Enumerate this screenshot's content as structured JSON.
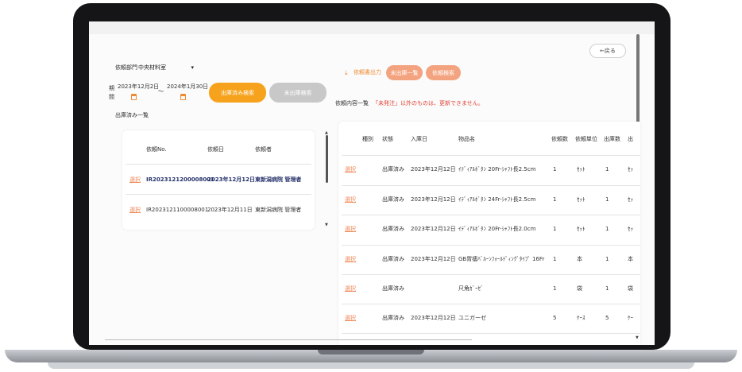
{
  "back_button": "←戻る",
  "filter": {
    "dept_label": "依頼部門",
    "dept_value": "中央材料室",
    "dept_chevron": "▾",
    "period_label": "期間",
    "date_from": "2023年12月2日",
    "date_separator": "～",
    "date_to": "2024年1月30日",
    "search_shipped_button": "出庫済み検索",
    "search_unshipped_button": "未出庫検索"
  },
  "actions": {
    "download_icon": "⤓",
    "request_output_label": "依頼書出力",
    "unshipped_list_button": "未出庫一覧",
    "request_search_button": "依頼検索"
  },
  "left_panel": {
    "title": "出庫済み一覧",
    "headers": [
      "依頼No.",
      "依頼日",
      "依頼者"
    ],
    "rows": [
      {
        "select": "選択",
        "no": "IR2023121200008001",
        "date": "2023年12月12日",
        "requester": "東新潟病院 管理者"
      },
      {
        "select": "選択",
        "no": "IR2023121100008001",
        "date": "2023年12月11日",
        "requester": "東新潟病院 管理者"
      }
    ]
  },
  "right_panel": {
    "title_prefix": "依頼内容一覧",
    "notice": "「未発注」以外のものは、更新できません。",
    "headers": [
      "種別",
      "状態",
      "入庫日",
      "物品名",
      "依頼数",
      "依頼単位",
      "出庫数",
      "出"
    ],
    "rows": [
      {
        "select": "選択",
        "status": "出庫済み",
        "date": "2023年12月12日",
        "item": "ｲﾃﾞｨｱﾙﾎﾞﾀﾝ 20Fr-ｼｬﾌﾄ長2.5cm",
        "qty": "1",
        "unit": "ｾｯﾄ",
        "out_qty": "1",
        "out_unit": "ｾｯ"
      },
      {
        "select": "選択",
        "status": "出庫済み",
        "date": "2023年12月12日",
        "item": "ｲﾃﾞｨｱﾙﾎﾞﾀﾝ 24Fr-ｼｬﾌﾄ長2.5cm",
        "qty": "1",
        "unit": "ｾｯﾄ",
        "out_qty": "1",
        "out_unit": "ｾｯ"
      },
      {
        "select": "選択",
        "status": "出庫済み",
        "date": "2023年12月12日",
        "item": "ｲﾃﾞｨｱﾙﾎﾞﾀﾝ 20Fr-ｼｬﾌﾄ長2.0cm",
        "qty": "1",
        "unit": "ｾｯﾄ",
        "out_qty": "1",
        "out_unit": "ｾｯ"
      },
      {
        "select": "選択",
        "status": "出庫済み",
        "date": "2023年12月12日",
        "item": "GB胃瘻ﾊﾞﾙｰﾝﾌｫｰﾙﾃﾞｨﾝｸﾞﾀｲﾌﾟ 16Fr",
        "qty": "1",
        "unit": "本",
        "out_qty": "1",
        "out_unit": "本"
      },
      {
        "select": "選択",
        "status": "出庫済み",
        "date": "",
        "item": "尺角ｶﾞｰｾﾞ",
        "qty": "1",
        "unit": "袋",
        "out_qty": "1",
        "out_unit": "袋"
      },
      {
        "select": "選択",
        "status": "出庫済み",
        "date": "2023年12月12日",
        "item": "ユニガーゼ",
        "qty": "5",
        "unit": "ｹｰｽ",
        "out_qty": "5",
        "out_unit": "ｹｰ"
      }
    ]
  },
  "colors": {
    "accent_orange": "#f7a21c",
    "link_orange": "#f08a5a",
    "notice_red": "#e0463a"
  }
}
